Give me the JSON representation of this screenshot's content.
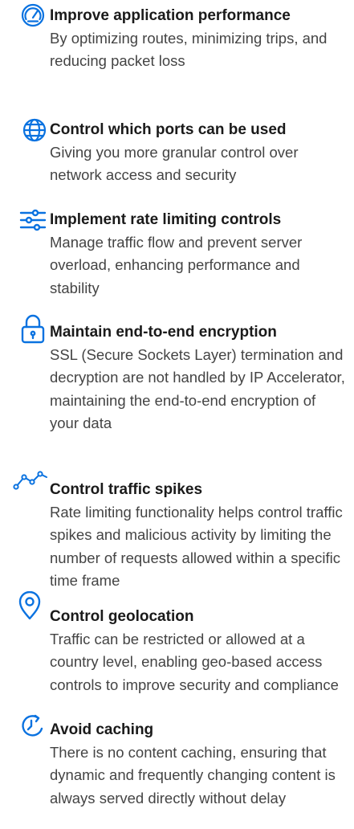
{
  "accent_color": "#0a72e0",
  "features": [
    {
      "icon": "speedometer-icon",
      "title": "Improve application performance",
      "description": "By optimizing routes, minimizing trips, and reducing packet loss"
    },
    {
      "icon": "globe-icon",
      "title": "Control which ports can be used",
      "description": "Giving you more granular control over network access and security"
    },
    {
      "icon": "sliders-icon",
      "title": "Implement rate limiting controls",
      "description": "Manage traffic flow and prevent server overload, enhancing performance and stability"
    },
    {
      "icon": "padlock-icon",
      "title": "Maintain end-to-end encryption",
      "description": "SSL (Secure Sockets Layer) termination and decryption are not handled by IP Accelerator, maintaining the end-to-end encryption of your data"
    },
    {
      "icon": "line-graph-icon",
      "title": "Control traffic spikes",
      "description": "Rate limiting functionality helps control traffic spikes and malicious activity by limiting the number of requests allowed within a specific time frame"
    },
    {
      "icon": "map-pin-icon",
      "title": "Control geolocation",
      "description": "Traffic can be restricted or allowed at a country level, enabling geo-based access controls to improve security and compliance"
    },
    {
      "icon": "clock-arrow-icon",
      "title": "Avoid caching",
      "description": "There is no content caching, ensuring that dynamic and frequently changing content is always served directly without delay"
    }
  ]
}
